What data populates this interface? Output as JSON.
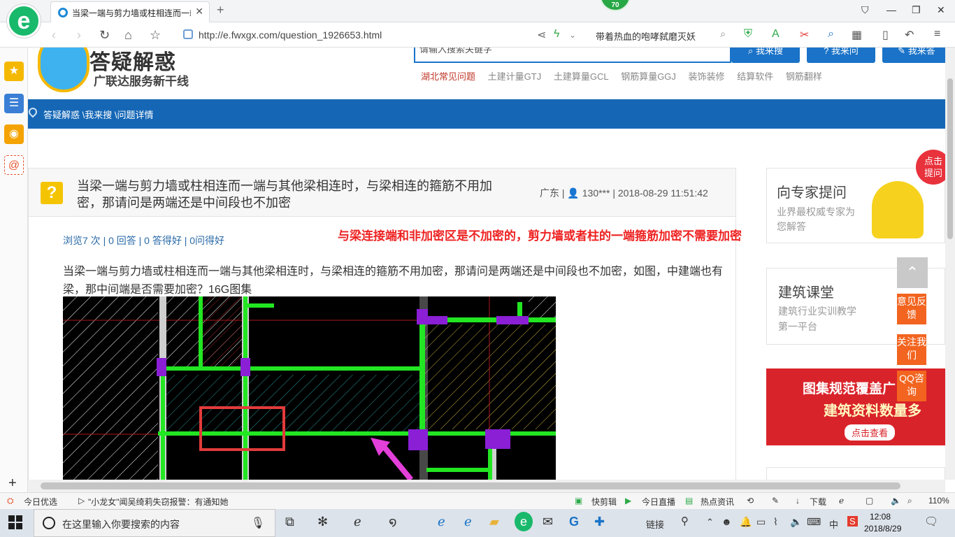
{
  "browser": {
    "logo_letter": "e",
    "tab_title": "当梁一端与剪力墙或柱相连而一端与其他梁相连时，与梁相连的箍筋不用加密",
    "tab_close": "✕",
    "new_tab": "+",
    "badge": "70",
    "url": "http://e.fwxgx.com/question_1926653.html",
    "search_text": "带着热血的咆哮弑磨灭妖",
    "window_buttons": [
      "⛉",
      "—",
      "❐",
      "✕"
    ]
  },
  "site": {
    "logo_title": "答疑解惑",
    "logo_sub": "广联达服务新干线",
    "search_placeholder": "请输入搜索关键字",
    "btn_search": "我来搜",
    "btn_ask": "我来问",
    "btn_answer": "我来答",
    "hot_links": [
      "湖北常见问题",
      "土建计量GTJ",
      "土建算量GCL",
      "钢筋算量GGJ",
      "装饰装修",
      "结算软件",
      "钢筋翻样"
    ],
    "breadcrumb": "答疑解惑 \\我来搜 \\问题详情"
  },
  "question": {
    "title": "当梁一端与剪力墙或柱相连而一端与其他梁相连时，与梁相连的箍筋不用加密，那请问是两端还是中间段也不加密",
    "region": "广东",
    "user": "130***",
    "time": "2018-08-29 11:51:42",
    "stats": "浏览7 次 | 0 回答 | 0 答得好 | 0问得好",
    "body": "当梁一端与剪力墙或柱相连而一端与其他梁相连时，与梁相连的箍筋不用加密，那请问是两端还是中间段也不加密，如图，中建端也有梁，那中间端是否需要加密？16G图集",
    "annotation": "与梁连接端和非加密区是不加密的，剪力墙或者柱的一端箍筋加密不需要加密"
  },
  "right_panel": {
    "expert_title": "向专家提问",
    "expert_sub": "业界最权威专家为您解答",
    "class_title": "建筑课堂",
    "class_sub": "建筑行业实训教学第一平台",
    "banner_l1": "图集规范覆盖广",
    "banner_l2": "建筑资料数量多",
    "banner_btn": "点击查看",
    "tip_bubble": "点击提问",
    "float_feedback": "意见反馈",
    "float_follow": "关注我们",
    "float_qq": "QQ咨询"
  },
  "statusbar": {
    "today": "今日优选",
    "news": "\"小龙女\"闻吴绮莉失窃报警：有通知她",
    "quick_cut": "快剪辑",
    "live": "今日直播",
    "hot": "热点资讯",
    "download": "下载",
    "zoom": "110%"
  },
  "taskbar": {
    "search_placeholder": "在这里输入你要搜索的内容",
    "link": "链接",
    "lang": "中",
    "time": "12:08",
    "date": "2018/8/29"
  }
}
